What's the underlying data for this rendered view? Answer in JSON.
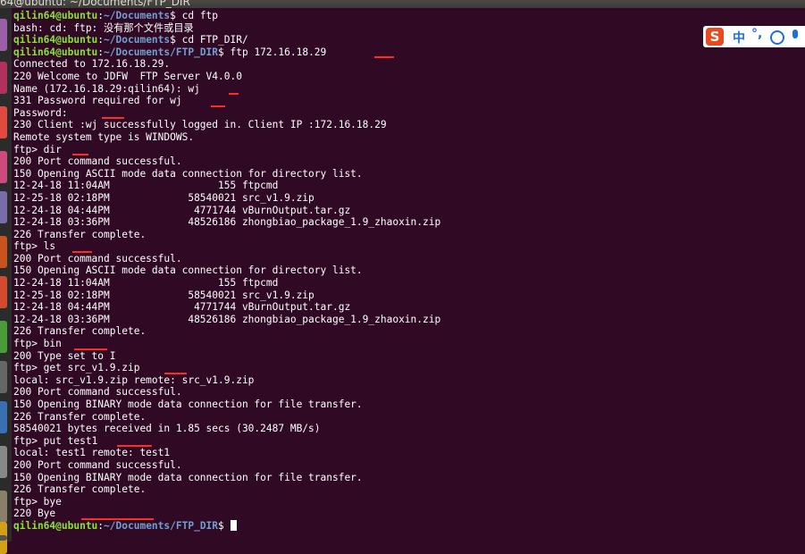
{
  "window": {
    "title": "64@ubuntu: ~/Documents/FTP_DIR"
  },
  "launcher": {
    "icon_colors": [
      "#9b5fa8",
      "#b03060",
      "#e04a3f",
      "#cc4a7e",
      "#7a6ca8",
      "#c9531f",
      "#d24b2f",
      "#4a9c3a",
      "#666666",
      "#3a6fb2",
      "#888888",
      "#8a7f6a",
      "#d4a017",
      "#555555"
    ]
  },
  "ime": {
    "logo": "S",
    "mode": "中",
    "punctuation": "°,"
  },
  "prompt": {
    "user": "qilin64@ubuntu",
    "sep": ":"
  },
  "terminal": {
    "lines": [
      {
        "type": "prompt",
        "path": "~/Documents",
        "cmd": "$ cd ftp"
      },
      {
        "type": "out",
        "text": "bash: cd: ftp: 没有那个文件或目录"
      },
      {
        "type": "prompt",
        "path": "~/Documents",
        "cmd": "$ cd FTP_DIR/"
      },
      {
        "type": "prompt",
        "path": "~/Documents/FTP_DIR",
        "cmd": "$ ftp 172.16.18.29"
      },
      {
        "type": "out",
        "text": "Connected to 172.16.18.29."
      },
      {
        "type": "out",
        "text": "220 Welcome to JDFW  FTP Server V4.0.0"
      },
      {
        "type": "out",
        "text": "Name (172.16.18.29:qilin64): wj"
      },
      {
        "type": "out",
        "text": "331 Password required for wj"
      },
      {
        "type": "out",
        "text": "Password:"
      },
      {
        "type": "out",
        "text": "230 Client :wj successfully logged in. Client IP :172.16.18.29"
      },
      {
        "type": "out",
        "text": "Remote system type is WINDOWS."
      },
      {
        "type": "out",
        "text": "ftp> dir"
      },
      {
        "type": "out",
        "text": "200 Port command successful."
      },
      {
        "type": "out",
        "text": "150 Opening ASCII mode data connection for directory list."
      },
      {
        "type": "out",
        "text": "12-24-18 11:04AM                  155 ftpcmd"
      },
      {
        "type": "out",
        "text": "12-25-18 02:18PM             58540021 src_v1.9.zip"
      },
      {
        "type": "out",
        "text": "12-24-18 04:44PM              4771744 vBurnOutput.tar.gz"
      },
      {
        "type": "out",
        "text": "12-24-18 03:36PM             48526186 zhongbiao_package_1.9_zhaoxin.zip"
      },
      {
        "type": "out",
        "text": "226 Transfer complete."
      },
      {
        "type": "out",
        "text": "ftp> ls"
      },
      {
        "type": "out",
        "text": "200 Port command successful."
      },
      {
        "type": "out",
        "text": "150 Opening ASCII mode data connection for directory list."
      },
      {
        "type": "out",
        "text": "12-24-18 11:04AM                  155 ftpcmd"
      },
      {
        "type": "out",
        "text": "12-25-18 02:18PM             58540021 src_v1.9.zip"
      },
      {
        "type": "out",
        "text": "12-24-18 04:44PM              4771744 vBurnOutput.tar.gz"
      },
      {
        "type": "out",
        "text": "12-24-18 03:36PM             48526186 zhongbiao_package_1.9_zhaoxin.zip"
      },
      {
        "type": "out",
        "text": "226 Transfer complete."
      },
      {
        "type": "out",
        "text": "ftp> bin"
      },
      {
        "type": "out",
        "text": "200 Type set to I"
      },
      {
        "type": "out",
        "text": "ftp> get src_v1.9.zip"
      },
      {
        "type": "out",
        "text": "local: src_v1.9.zip remote: src_v1.9.zip"
      },
      {
        "type": "out",
        "text": "200 Port command successful."
      },
      {
        "type": "out",
        "text": "150 Opening BINARY mode data connection for file transfer."
      },
      {
        "type": "out",
        "text": "226 Transfer complete."
      },
      {
        "type": "out",
        "text": "58540021 bytes received in 1.85 secs (30.2487 MB/s)"
      },
      {
        "type": "out",
        "text": "ftp> put test1"
      },
      {
        "type": "out",
        "text": "local: test1 remote: test1"
      },
      {
        "type": "out",
        "text": "200 Port command successful."
      },
      {
        "type": "out",
        "text": "150 Opening BINARY mode data connection for file transfer."
      },
      {
        "type": "out",
        "text": "226 Transfer complete."
      },
      {
        "type": "out",
        "text": "ftp> bye"
      },
      {
        "type": "out",
        "text": "220 Bye"
      },
      {
        "type": "prompt",
        "path": "~/Documents/FTP_DIR",
        "cmd": "$ ",
        "cursor": true
      }
    ]
  },
  "annotation_color": "#ff2a2a"
}
